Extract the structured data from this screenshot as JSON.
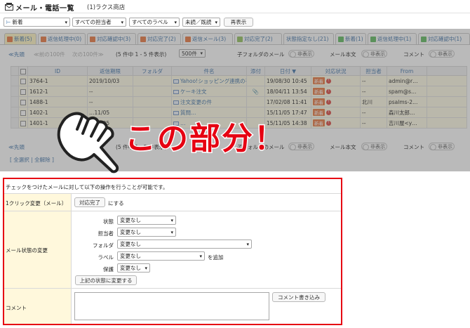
{
  "header": {
    "title": "メール・電話一覧",
    "shop": "(1)ラクス商店"
  },
  "filters": {
    "status": "新着",
    "assignee": "すべての担当者",
    "label": "すべてのラベル",
    "read": "未読／既読",
    "redisplay": "再表示"
  },
  "tabs": [
    {
      "label": "新着(5)",
      "color": "#e8743b"
    },
    {
      "label": "返信処理中(0)",
      "color": "#e8743b"
    },
    {
      "label": "対応確認中(3)",
      "color": "#e8743b"
    },
    {
      "label": "対応完了(2)",
      "color": "#e8743b"
    },
    {
      "label": "返信メール(3)",
      "color": "#e8743b"
    },
    {
      "label": "対応完了(2)",
      "color": "#8fbf5a"
    },
    {
      "label": "状態指定なし(21)",
      "color": ""
    },
    {
      "label": "新着(1)",
      "color": "#5cb85c"
    },
    {
      "label": "返信処理中(1)",
      "color": "#5cb85c"
    },
    {
      "label": "対応確認中(1)",
      "color": "#5cb85c"
    }
  ],
  "pager": {
    "first": "≪先頭",
    "prev": "≪前の100件",
    "next": "次の100件≫",
    "count": "(5 件中 1 - 5 件表示)",
    "per_page": "500件",
    "subfolder_label": "子フォルダのメール",
    "body_label": "メール本文",
    "comment_label": "コメント",
    "hidden": "非表示"
  },
  "columns": [
    "ID",
    "返信期限",
    "フォルダ",
    "件名",
    "添付",
    "日付 ▼",
    "対応状況",
    "担当者",
    "From"
  ],
  "rows": [
    {
      "id": "3764-1",
      "deadline": "2019/10/03",
      "folder": "",
      "subject": "Yahoo!ショッピング連携の有効…",
      "attach": "",
      "date": "19/08/30 10:45",
      "status": "新着",
      "assignee": "--",
      "from": "admin@r…"
    },
    {
      "id": "1612-1",
      "deadline": "--",
      "folder": "",
      "subject": "ケーキ注文",
      "attach": "📎",
      "date": "18/04/11 13:54",
      "status": "新着",
      "assignee": "--",
      "from": "spam@s…"
    },
    {
      "id": "1488-1",
      "deadline": "--",
      "folder": "",
      "subject": "注文変更の件",
      "attach": "",
      "date": "17/02/08 11:41",
      "status": "新着",
      "assignee": "北川",
      "from": "psalms-2…"
    },
    {
      "id": "1402-1",
      "deadline": "…11/05",
      "folder": "",
      "subject": "質問…",
      "attach": "",
      "date": "15/11/05 17:47",
      "status": "新着",
      "assignee": "--",
      "from": "森川太郎…"
    },
    {
      "id": "1401-1",
      "deadline": "…11/05",
      "folder": "",
      "subject": "…",
      "attach": "",
      "date": "15/11/05 14:38",
      "status": "新着",
      "assignee": "--",
      "from": "吉川屋<y…"
    }
  ],
  "select_all": "[ 全選択 | 全解除 ]",
  "callout": "この部分！",
  "panel": {
    "intro": "チェックをつけたメールに対して以下の操作を行うことが可能です。",
    "oneclick_label": "1クリック変更（メール）",
    "oneclick_button": "対応完了",
    "oneclick_suffix": "にする",
    "status_change_label": "メール状態の変更",
    "fields": {
      "status_label": "状態",
      "status_value": "変更なし",
      "assignee_label": "担当者",
      "assignee_value": "変更なし",
      "folder_label": "フォルダ",
      "folder_value": "変更なし",
      "label_label": "ラベル",
      "label_value": "変更なし",
      "label_suffix": "を追加",
      "protect_label": "保護",
      "protect_value": "変更なし"
    },
    "apply_button": "上記の状態に変更する",
    "comment_label": "コメント",
    "comment_button": "コメント書き込み"
  }
}
